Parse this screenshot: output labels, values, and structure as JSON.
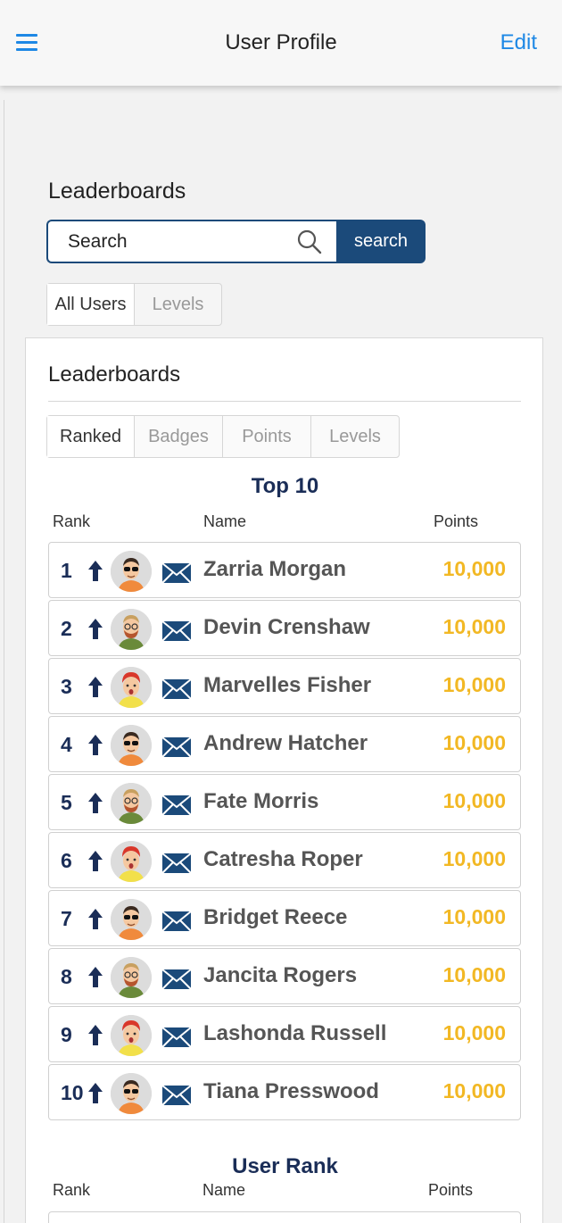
{
  "header": {
    "title": "User Profile",
    "edit_label": "Edit"
  },
  "page": {
    "heading": "Leaderboards",
    "search": {
      "placeholder": "Search",
      "button_label": "search"
    },
    "filter_tabs": [
      {
        "label": "All Users",
        "active": true
      },
      {
        "label": "Levels",
        "active": false
      }
    ]
  },
  "card": {
    "heading": "Leaderboards",
    "tabs": [
      {
        "label": "Ranked",
        "active": true
      },
      {
        "label": "Badges",
        "active": false
      },
      {
        "label": "Points",
        "active": false
      },
      {
        "label": "Levels",
        "active": false
      }
    ],
    "top10": {
      "title": "Top 10",
      "col_rank": "Rank",
      "col_name": "Name",
      "col_points": "Points",
      "rows": [
        {
          "rank": "1",
          "name": "Zarria Morgan",
          "points": "10,000",
          "avatar": "sunglasses-avatar-icon"
        },
        {
          "rank": "2",
          "name": "Devin Crenshaw",
          "points": "10,000",
          "avatar": "glasses-beard-avatar-icon"
        },
        {
          "rank": "3",
          "name": "Marvelles Fisher",
          "points": "10,000",
          "avatar": "redhead-avatar-icon"
        },
        {
          "rank": "4",
          "name": "Andrew Hatcher",
          "points": "10,000",
          "avatar": "sunglasses-avatar-icon"
        },
        {
          "rank": "5",
          "name": "Fate Morris",
          "points": "10,000",
          "avatar": "glasses-beard-avatar-icon"
        },
        {
          "rank": "6",
          "name": "Catresha Roper",
          "points": "10,000",
          "avatar": "redhead-avatar-icon"
        },
        {
          "rank": "7",
          "name": "Bridget Reece",
          "points": "10,000",
          "avatar": "sunglasses-avatar-icon"
        },
        {
          "rank": "8",
          "name": "Jancita Rogers",
          "points": "10,000",
          "avatar": "glasses-beard-avatar-icon"
        },
        {
          "rank": "9",
          "name": "Lashonda Russell",
          "points": "10,000",
          "avatar": "redhead-avatar-icon"
        },
        {
          "rank": "10",
          "name": "Tiana Presswood",
          "points": "10,000",
          "avatar": "sunglasses-avatar-icon"
        }
      ]
    },
    "user_rank": {
      "title": "User Rank",
      "col_rank": "Rank",
      "col_name": "Name",
      "col_points": "Points"
    }
  },
  "colors": {
    "accent": "#1e88e5",
    "navy": "#1b4a7a",
    "rank_text": "#1a2d57",
    "points": "#f2b824"
  }
}
